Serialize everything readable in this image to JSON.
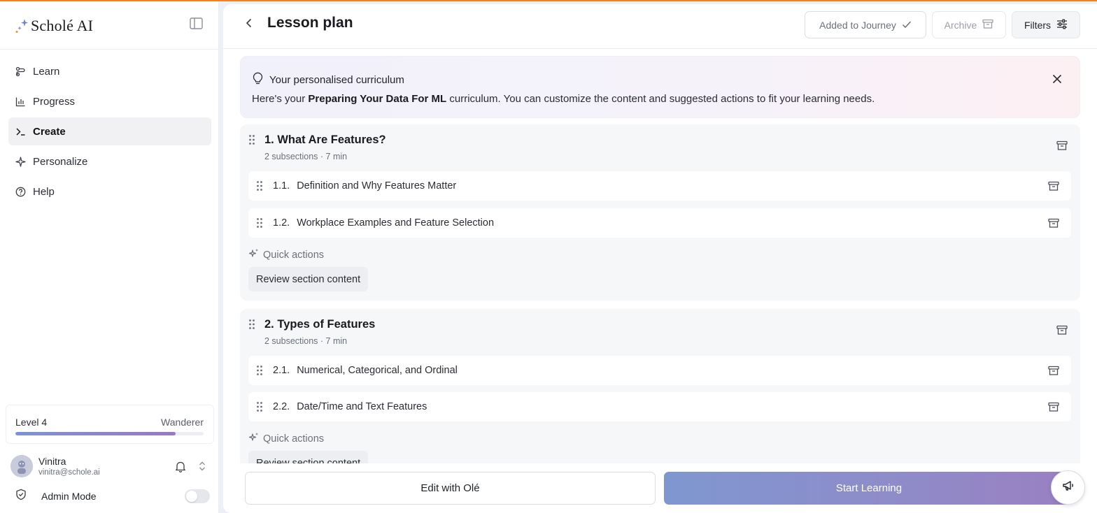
{
  "app": {
    "brand": "Scholé AI",
    "accent_color": "#f0831f"
  },
  "sidebar": {
    "items": [
      {
        "label": "Learn",
        "icon": "route-icon",
        "active": false
      },
      {
        "label": "Progress",
        "icon": "bar-chart-icon",
        "active": false
      },
      {
        "label": "Create",
        "icon": "terminal-icon",
        "active": true
      },
      {
        "label": "Personalize",
        "icon": "sparkle-icon",
        "active": false
      },
      {
        "label": "Help",
        "icon": "help-circle-icon",
        "active": false
      }
    ],
    "level": {
      "label": "Level 4",
      "rank": "Wanderer",
      "progress": 0.85
    },
    "user": {
      "name": "Vinitra",
      "email": "vinitra@schole.ai"
    },
    "admin_mode": {
      "label": "Admin Mode",
      "enabled": false
    }
  },
  "header": {
    "title": "Lesson plan",
    "journey_label": "Added to Journey",
    "archive_label": "Archive",
    "filters_label": "Filters"
  },
  "banner": {
    "title": "Your personalised curriculum",
    "text_before": "Here's your ",
    "topic": "Preparing Your Data For ML",
    "text_after": " curriculum. You can customize the content and suggested actions to fit your learning needs."
  },
  "sections": [
    {
      "title": "1. What Are Features?",
      "meta": "2 subsections · 7 min",
      "subsections": [
        {
          "num": "1.1.",
          "label": "Definition and Why Features Matter"
        },
        {
          "num": "1.2.",
          "label": "Workplace Examples and Feature Selection"
        }
      ],
      "quick_actions_label": "Quick actions",
      "quick_action": "Review section content"
    },
    {
      "title": "2. Types of Features",
      "meta": "2 subsections · 7 min",
      "subsections": [
        {
          "num": "2.1.",
          "label": "Numerical, Categorical, and Ordinal"
        },
        {
          "num": "2.2.",
          "label": "Date/Time and Text Features"
        }
      ],
      "quick_actions_label": "Quick actions",
      "quick_action": "Review section content"
    }
  ],
  "footer": {
    "edit_label": "Edit with Olé",
    "start_label": "Start Learning"
  }
}
